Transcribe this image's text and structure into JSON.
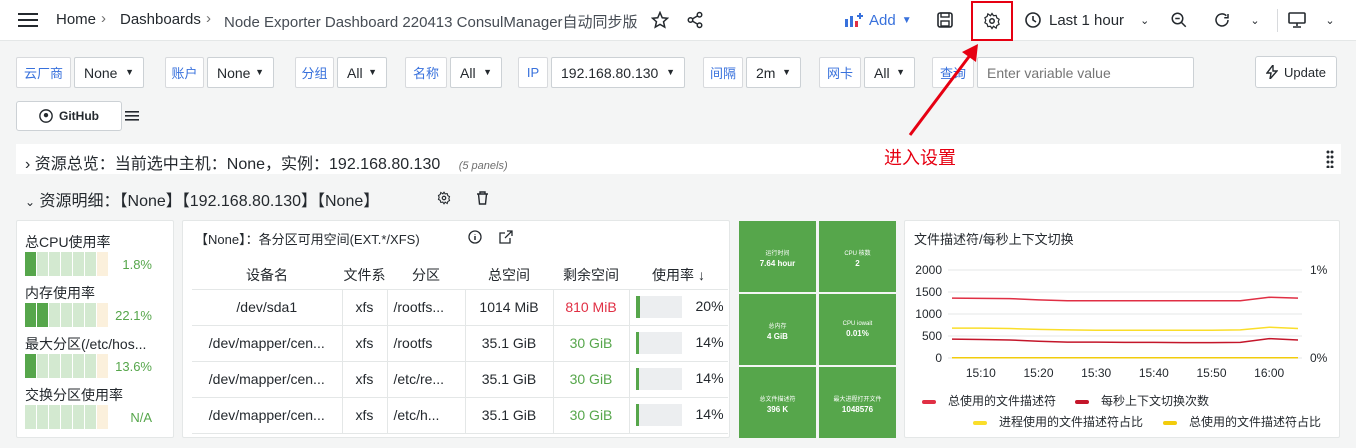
{
  "breadcrumb": {
    "home": "Home",
    "dashboards": "Dashboards",
    "dashboard_title": "Node Exporter Dashboard 220413 ConsulManager自动同步版"
  },
  "toolbar": {
    "add_label": "Add",
    "time_range": "Last 1 hour"
  },
  "variables": [
    {
      "label": "云厂商",
      "value": "None"
    },
    {
      "label": "账户",
      "value": "None"
    },
    {
      "label": "分组",
      "value": "All"
    },
    {
      "label": "名称",
      "value": "All"
    },
    {
      "label": "IP",
      "value": "192.168.80.130"
    },
    {
      "label": "间隔",
      "value": "2m"
    },
    {
      "label": "网卡",
      "value": "All"
    },
    {
      "label": "查询",
      "placeholder": "Enter variable value"
    }
  ],
  "update_label": "Update",
  "github_label": "GitHub",
  "rows": {
    "overview": "资源总览：当前选中主机：None，实例：192.168.80.130",
    "overview_panels": "(5 panels)",
    "detail": "资源明细：【None】【192.168.80.130】【None】"
  },
  "annotation": "进入设置",
  "stats": [
    {
      "label": "总CPU使用率",
      "value": "1.8%",
      "level": 1
    },
    {
      "label": "内存使用率",
      "value": "22.1%",
      "level": 2
    },
    {
      "label": "最大分区(/etc/hos...",
      "value": "13.6%",
      "level": 1
    },
    {
      "label": "交换分区使用率",
      "value": "N/A",
      "level": 0
    }
  ],
  "disk_panel": {
    "title": "【None】：各分区可用空间(EXT.*/XFS)",
    "columns": [
      "设备名",
      "文件系",
      "分区",
      "总空间",
      "剩余空间",
      "使用率"
    ],
    "rows": [
      {
        "device": "/dev/sda1",
        "fs": "xfs",
        "mount": "/rootfs...",
        "total": "1014 MiB",
        "free": "810 MiB",
        "free_status": "red",
        "usage": "20%",
        "usage_fraction": 0.2
      },
      {
        "device": "/dev/mapper/cen...",
        "fs": "xfs",
        "mount": "/rootfs",
        "total": "35.1 GiB",
        "free": "30 GiB",
        "free_status": "green",
        "usage": "14%",
        "usage_fraction": 0.14
      },
      {
        "device": "/dev/mapper/cen...",
        "fs": "xfs",
        "mount": "/etc/re...",
        "total": "35.1 GiB",
        "free": "30 GiB",
        "free_status": "green",
        "usage": "14%",
        "usage_fraction": 0.14
      },
      {
        "device": "/dev/mapper/cen...",
        "fs": "xfs",
        "mount": "/etc/h...",
        "total": "35.1 GiB",
        "free": "30 GiB",
        "free_status": "green",
        "usage": "14%",
        "usage_fraction": 0.14
      }
    ]
  },
  "tiles": [
    {
      "title": "运行时间",
      "value": "7.64 hour"
    },
    {
      "title": "CPU 核数",
      "value": "2"
    },
    {
      "title": "总内存",
      "value": "4 GiB"
    },
    {
      "title": "CPU iowait",
      "value": "0.01%"
    },
    {
      "title": "总文件描述符",
      "value": "396 K"
    },
    {
      "title": "最大进程打开文件",
      "value": "1048576"
    }
  ],
  "chart_panel": {
    "title": "文件描述符/每秒上下文切换"
  },
  "chart_data": {
    "type": "line",
    "x": [
      "15:05",
      "15:10",
      "15:15",
      "15:20",
      "15:25",
      "15:30",
      "15:35",
      "15:40",
      "15:45",
      "15:50",
      "15:55",
      "16:00",
      "16:03"
    ],
    "y_left_ticks": [
      "2000",
      "1500",
      "1000",
      "500",
      "0"
    ],
    "y_left_range": [
      0,
      2000
    ],
    "y_right_ticks": [
      "1%",
      "0%"
    ],
    "x_ticks": [
      "15:10",
      "15:20",
      "15:30",
      "15:40",
      "15:50",
      "16:00"
    ],
    "series": [
      {
        "name": "总使用的文件描述符",
        "color": "#e02f44",
        "values": [
          1360,
          1355,
          1350,
          1320,
          1300,
          1300,
          1300,
          1300,
          1300,
          1300,
          1300,
          1380,
          1360
        ]
      },
      {
        "name": "每秒上下文切换次数",
        "color": "#c4162a",
        "values": [
          430,
          420,
          410,
          380,
          360,
          360,
          355,
          355,
          350,
          350,
          355,
          440,
          410
        ]
      },
      {
        "name": "进程使用的文件描述符占比",
        "color": "#fade2a",
        "values": [
          680,
          680,
          670,
          650,
          640,
          630,
          630,
          630,
          630,
          630,
          640,
          700,
          670
        ]
      },
      {
        "name": "总使用的文件描述符占比",
        "color": "#f2cc0c",
        "values": [
          5,
          5,
          5,
          5,
          5,
          5,
          5,
          5,
          5,
          5,
          5,
          5,
          5
        ]
      }
    ],
    "legend_placement": "bottom",
    "grid": true
  }
}
